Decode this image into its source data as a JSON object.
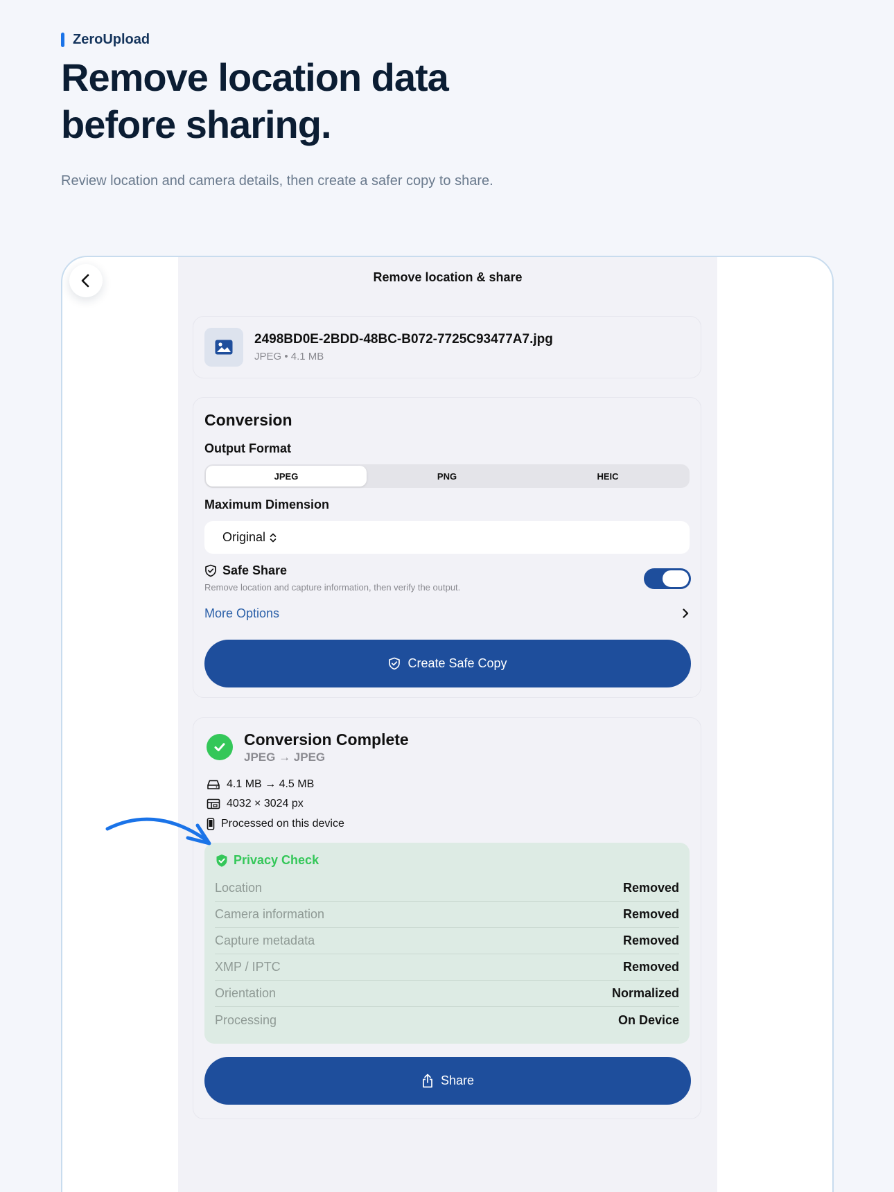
{
  "brand": {
    "name": "ZeroUpload",
    "accent": "#1a73e8"
  },
  "hero": {
    "headline_line1": "Remove location data",
    "headline_line2": "before sharing.",
    "subtitle": "Review location and camera details, then create a safer copy to share."
  },
  "screen": {
    "nav_title": "Remove location & share",
    "file": {
      "name": "2498BD0E-2BDD-48BC-B072-7725C93477A7.jpg",
      "meta": "JPEG • 4.1 MB"
    },
    "conversion": {
      "title": "Conversion",
      "output_format_label": "Output Format",
      "formats": [
        "JPEG",
        "PNG",
        "HEIC"
      ],
      "selected_format": "JPEG",
      "max_dimension_label": "Maximum Dimension",
      "max_dimension_value": "Original",
      "safe_share_title": "Safe Share",
      "safe_share_desc": "Remove location and capture information, then verify the output.",
      "safe_share_enabled": true,
      "more_options_label": "More Options",
      "create_button_label": "Create Safe Copy"
    },
    "result": {
      "title": "Conversion Complete",
      "subtitle": "JPEG → JPEG",
      "size_change": "4.1 MB → 4.5 MB",
      "dimensions": "4032 × 3024 px",
      "processed": "Processed on this device",
      "privacy_check": {
        "title": "Privacy Check",
        "rows": [
          {
            "key": "Location",
            "value": "Removed"
          },
          {
            "key": "Camera information",
            "value": "Removed"
          },
          {
            "key": "Capture metadata",
            "value": "Removed"
          },
          {
            "key": "XMP / IPTC",
            "value": "Removed"
          },
          {
            "key": "Orientation",
            "value": "Normalized"
          },
          {
            "key": "Processing",
            "value": "On Device"
          }
        ]
      },
      "share_button_label": "Share"
    }
  },
  "colors": {
    "primary": "#1e4e9c",
    "success": "#34c759",
    "privacy_bg": "#ddebe4",
    "link": "#2a5fa8"
  },
  "icons": [
    "chevron-left-icon",
    "image-icon",
    "chevron-up-down-icon",
    "shield-check-icon",
    "chevron-right-icon",
    "checkmark-icon",
    "drive-icon",
    "dimensions-icon",
    "phone-icon",
    "share-icon",
    "arrow-annotation-icon"
  ]
}
